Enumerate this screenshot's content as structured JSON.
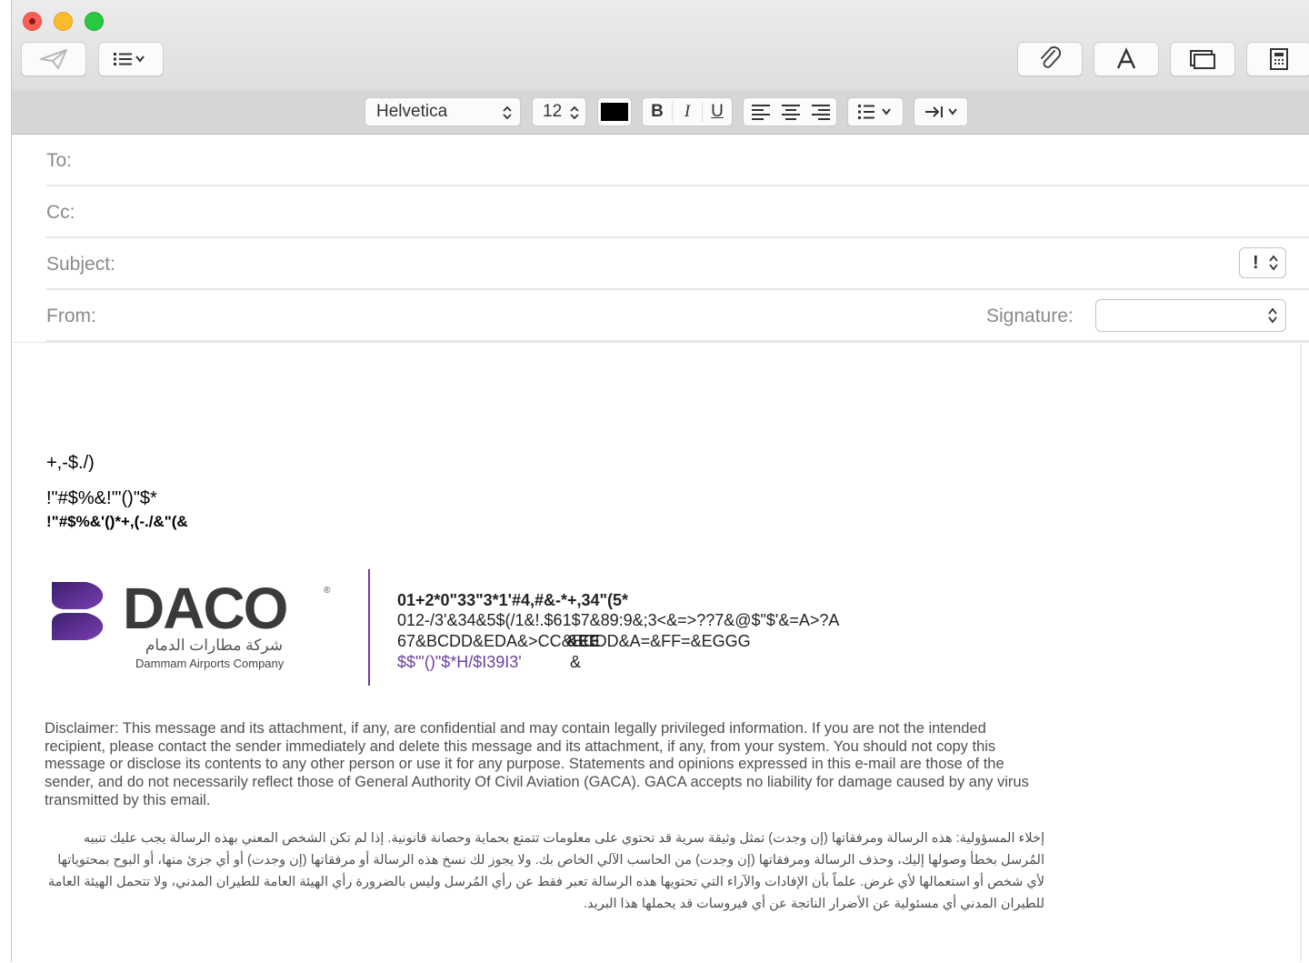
{
  "toolbar": {
    "icons": [
      "send-icon",
      "list-format-icon",
      "attachment-icon",
      "font-icon",
      "window-icon",
      "calculator-icon"
    ]
  },
  "format": {
    "font": "Helvetica",
    "size": "12",
    "color": "#000000",
    "bold": "B",
    "italic": "I",
    "underline": "U"
  },
  "headers": {
    "to_label": "To:",
    "cc_label": "Cc:",
    "subject_label": "Subject:",
    "from_label": "From:",
    "signature_label": "Signature:",
    "priority_label": "!"
  },
  "body": {
    "line1": "+,-$./)",
    "line2": "!\"#$%&!'\"()\"$*",
    "line3": "!\"#$%&'()*+,(-./&\"(&"
  },
  "signature_block": {
    "logo_text": "DACO",
    "logo_arabic": "شركة مطارات الدمام",
    "logo_english": "Dammam Airports Company",
    "l1": "01+2*0\"33\"3*1'#4,#&-*+,34\"(5*",
    "l2": "012-/3'&34&5$(/1&!.$61$7&89:9&;3<&=>??7&@$\"$'&=A>?A",
    "l3": "67&BCDD&EDA&>CC&BCDD&A=&FF=&EGGG",
    "l3_overlap": "&EE",
    "l4": "$$\"'()\"$*H/$I39I3'",
    "l4_amp": "&"
  },
  "disclaimer": "Disclaimer: This message and its attachment, if any, are confidential and may contain legally privileged information. If you are not the intended recipient, please contact the sender immediately and delete this message and its attachment, if any, from your system. You should not copy this message or disclose its contents to any other person or use it for any purpose. Statements and opinions expressed in this e-mail are those of the sender, and do not necessarily reflect those of General Authority Of Civil Aviation (GACA). GACA accepts no liability for damage caused by any virus transmitted by this email.",
  "disclaimer_ar": "إخلاء المسؤولية: هذه الرسالة ومرفقاتها (إن وجدت) تمثل وثيقة سرية قد تحتوي على معلومات تتمتع بحماية وحصانة قانونية. إذا لم تكن الشخص المعني بهذه الرسالة يجب عليك تنبيه المُرسل بخطأ وصولها إليك، وحذف الرسالة ومرفقاتها (إن وجدت) من الحاسب الآلي الخاص بك. ولا يجوز لك نسخ هذه الرسالة أو مرفقاتها (إن وجدت) أو أي جزئ منها، أو البوح بمحتوياتها لأي شخص أو استعمالها لأي غرض. علماً بأن الإفادات والآراء التي تحتويها هذه الرسالة تعبر فقط عن رأي المُرسل وليس بالضرورة رأي الهيئة العامة للطيران المدني، ولا تتحمل الهيئة العامة للطيران المدني أي مسئولية عن الأضرار الناتجة عن أي فيروسات قد يحملها هذا البريد."
}
